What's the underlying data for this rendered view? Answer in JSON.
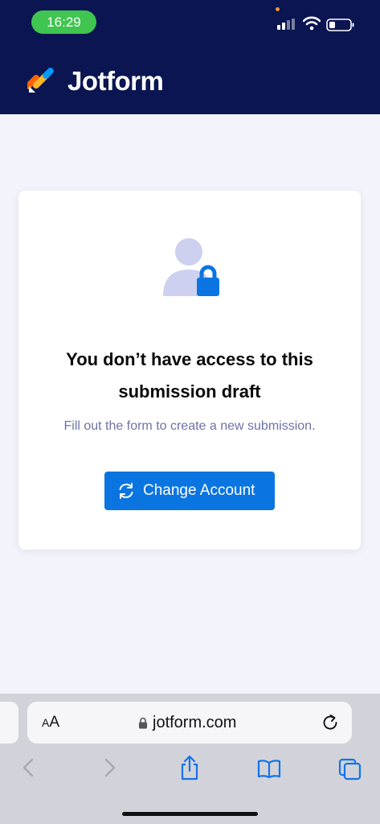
{
  "status_bar": {
    "time": "16:29",
    "icons": [
      "signal-icon",
      "wifi-icon",
      "battery-icon"
    ]
  },
  "header": {
    "brand": "Jotform",
    "logo_icon": "jotform-logo",
    "background": "#0a1551"
  },
  "card": {
    "illustration_icon": "user-lock-icon",
    "title_line1": "You don’t have access to this",
    "title_line2": "submission draft",
    "subtitle": "Fill out the form to create a new submission.",
    "button_label": "Change Account",
    "button_icon": "refresh-icon",
    "button_color": "#0a75e0"
  },
  "browser": {
    "text_size_small": "A",
    "text_size_large": "A",
    "url": "jotform.com",
    "toolbar_icons": [
      "back-icon",
      "forward-icon",
      "share-icon",
      "bookmarks-icon",
      "tabs-icon"
    ]
  }
}
